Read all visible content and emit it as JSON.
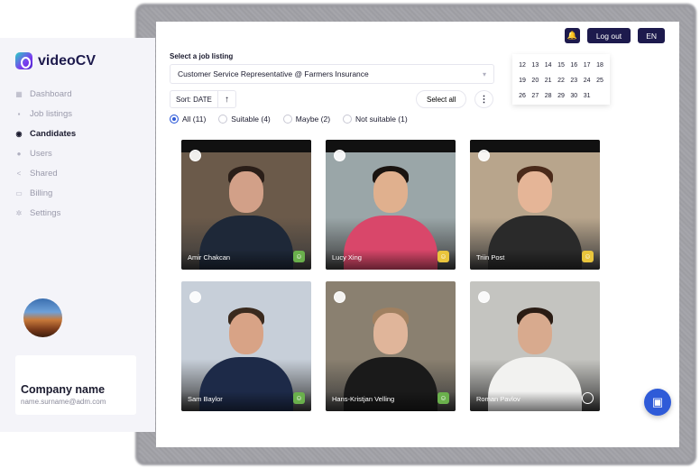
{
  "app": {
    "name": "videoCV"
  },
  "sidebar": {
    "items": [
      {
        "label": "Dashboard",
        "icon": "grid-icon"
      },
      {
        "label": "Job listings",
        "icon": "briefcase-icon"
      },
      {
        "label": "Candidates",
        "icon": "eye-icon",
        "active": true
      },
      {
        "label": "Users",
        "icon": "user-icon"
      },
      {
        "label": "Shared",
        "icon": "share-icon"
      },
      {
        "label": "Billing",
        "icon": "card-icon"
      },
      {
        "label": "Settings",
        "icon": "gear-icon"
      }
    ]
  },
  "company": {
    "name": "Company name",
    "email": "name.surname@adm.com"
  },
  "header": {
    "logout_label": "Log out",
    "language": "EN"
  },
  "job": {
    "label": "Select a job listing",
    "selected": "Customer Service Representative @ Farmers Insurance"
  },
  "sort": {
    "label": "Sort: DATE",
    "direction_icon": "arrow-up-icon"
  },
  "select_all_label": "Select all",
  "filters": [
    {
      "label": "All (11)",
      "checked": true
    },
    {
      "label": "Suitable (4)",
      "checked": false
    },
    {
      "label": "Maybe (2)",
      "checked": false
    },
    {
      "label": "Not suitable (1)",
      "checked": false
    }
  ],
  "calendar": {
    "rows": [
      [
        "12",
        "13",
        "14",
        "15",
        "16",
        "17",
        "18"
      ],
      [
        "19",
        "20",
        "21",
        "22",
        "23",
        "24",
        "25"
      ],
      [
        "26",
        "27",
        "28",
        "29",
        "30",
        "31",
        ""
      ]
    ]
  },
  "candidates": [
    {
      "name": "Amir Chakcan",
      "status": "suitable",
      "bg": "#6b5a4a",
      "body": "#1e2838",
      "skin": "#d2a088",
      "hair": "#2a1e18"
    },
    {
      "name": "Lucy Xing",
      "status": "maybe",
      "bg": "#9aa6a8",
      "body": "#d9476a",
      "skin": "#e0b08e",
      "hair": "#1a1410"
    },
    {
      "name": "Triin Post",
      "status": "maybe",
      "bg": "#b8a58c",
      "body": "#2a2a2a",
      "skin": "#e5b597",
      "hair": "#4a2a1a"
    },
    {
      "name": "Sam Baylor",
      "status": "suitable",
      "bg": "#c7cfd9",
      "body": "#1d2a48",
      "skin": "#d8a386",
      "hair": "#3a2a1e"
    },
    {
      "name": "Hans-Kristjan Velling",
      "status": "suitable",
      "bg": "#8a8070",
      "body": "#1a1a1a",
      "skin": "#e0b59a",
      "hair": "#a08060"
    },
    {
      "name": "Roman Pavlov",
      "status": "none",
      "bg": "#c4c4c0",
      "body": "#f2f2f0",
      "skin": "#d8aa8e",
      "hair": "#2a1c14"
    }
  ],
  "colors": {
    "accent": "#2f5bd8",
    "brand_dark": "#1d1a4d",
    "suitable": "#6ab04c",
    "maybe": "#e9c53c"
  }
}
